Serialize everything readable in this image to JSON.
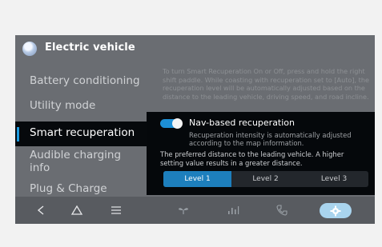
{
  "header": {
    "title": "Electric vehicle",
    "icon": "ev-globe-icon"
  },
  "menu": {
    "items": [
      {
        "label": "Battery conditioning",
        "selected": false
      },
      {
        "label": "Utility mode",
        "selected": false
      },
      {
        "label": "Smart recuperation",
        "selected": true
      },
      {
        "label": "Audible charging info",
        "selected": false
      },
      {
        "label": "Plug & Charge",
        "selected": false
      }
    ]
  },
  "description": "To turn Smart Recuperation On or Off, press and hold the right shift paddle. While coasting with recuperation set to [Auto], the recuperation level will be automatically adjusted based on the distance to the leading vehicle, driving speed, and road incline.",
  "popup": {
    "toggle_on": true,
    "title": "Nav-based recuperation",
    "subtitle": "Recuperation intensity is automatically adjusted according to the map information.",
    "preference_text": "The preferred distance to the leading vehicle. A higher setting value results in a greater distance.",
    "levels": [
      "Level 1",
      "Level 2",
      "Level 3"
    ],
    "selected_level": "Level 1"
  },
  "navbar": {
    "icons": [
      "back-icon",
      "home-icon",
      "menu-icon",
      "climate-fan-icon",
      "media-bars-icon",
      "phone-icon",
      "settings-gear-icon"
    ],
    "active": "settings-gear-icon"
  },
  "colors": {
    "accent": "#1d9be0",
    "screen_bg": "#6a6d72",
    "selected_bg": "#06090c",
    "navbar_bg": "#585b60"
  }
}
